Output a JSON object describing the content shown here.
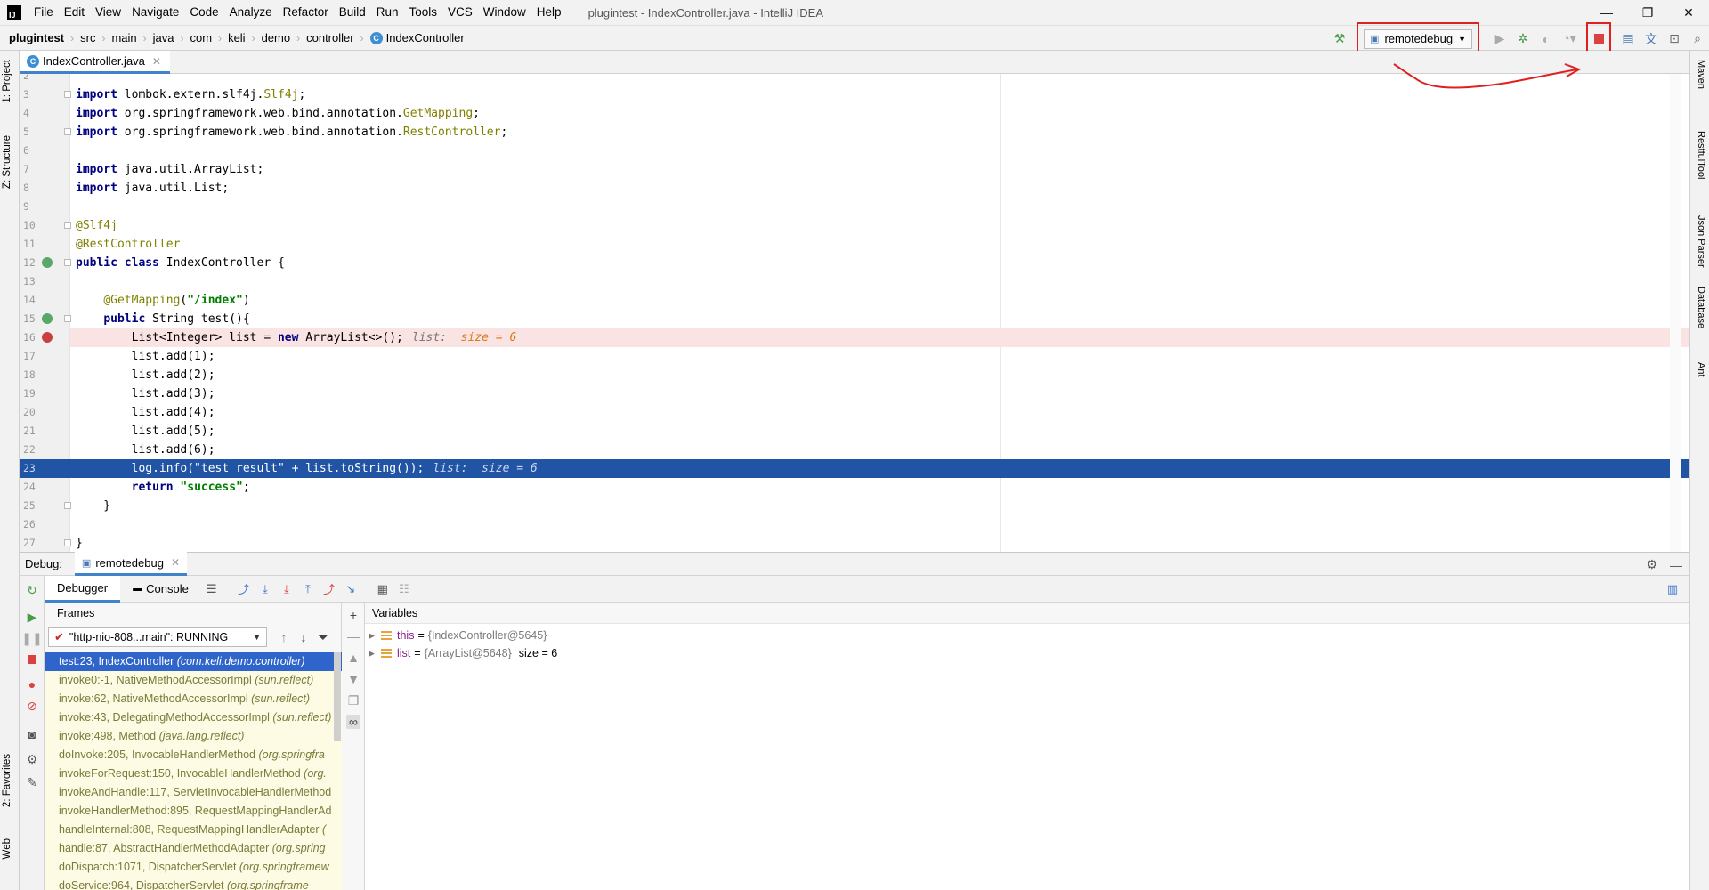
{
  "window": {
    "title": "plugintest - IndexController.java - IntelliJ IDEA",
    "menu": [
      "File",
      "Edit",
      "View",
      "Navigate",
      "Code",
      "Analyze",
      "Refactor",
      "Build",
      "Run",
      "Tools",
      "VCS",
      "Window",
      "Help"
    ],
    "controls": {
      "minimize": "—",
      "maximize": "❐",
      "close": "✕"
    }
  },
  "breadcrumb": {
    "project": "plugintest",
    "items": [
      "src",
      "main",
      "java",
      "com",
      "keli",
      "demo",
      "controller"
    ],
    "class_name": "IndexController"
  },
  "toolbar": {
    "run_config": "remotedebug",
    "accent_red": "#e02020"
  },
  "left_tool_tabs": {
    "project": "1: Project",
    "structure": "Z: Structure",
    "favorites": "2: Favorites",
    "web": "Web"
  },
  "right_tool_tabs": {
    "maven": "Maven",
    "restful": "RestfulTool",
    "json": "Json Parser",
    "database": "Database",
    "ant": "Ant"
  },
  "editor": {
    "tab": "IndexController.java",
    "lines": [
      {
        "n": "2",
        "html": ""
      },
      {
        "n": "3",
        "html": "<span class='kw'>import</span> lombok.extern.slf4j.<span class='ann'>Slf4j</span>;"
      },
      {
        "n": "4",
        "html": "<span class='kw'>import</span> org.springframework.web.bind.annotation.<span class='ann'>GetMapping</span>;"
      },
      {
        "n": "5",
        "html": "<span class='kw'>import</span> org.springframework.web.bind.annotation.<span class='ann'>RestController</span>;"
      },
      {
        "n": "6",
        "html": ""
      },
      {
        "n": "7",
        "html": "<span class='kw'>import</span> java.util.ArrayList;"
      },
      {
        "n": "8",
        "html": "<span class='kw'>import</span> java.util.List;"
      },
      {
        "n": "9",
        "html": ""
      },
      {
        "n": "10",
        "html": "<span class='ann'>@Slf4j</span>"
      },
      {
        "n": "11",
        "html": "<span class='ann'>@RestController</span>"
      },
      {
        "n": "12",
        "html": "<span class='kw'>public class</span> IndexController {"
      },
      {
        "n": "13",
        "html": ""
      },
      {
        "n": "14",
        "html": "    <span class='ann'>@GetMapping</span>(<span class='str'>\"/index\"</span>)"
      },
      {
        "n": "15",
        "html": "    <span class='kw'>public</span> String test(){"
      },
      {
        "n": "16",
        "html": "        List&lt;Integer&gt; list = <span class='kw'>new</span> ArrayList&lt;&gt;();<span class='inline-hint'>list:</span>  <span class='hint-val'>size = 6</span>"
      },
      {
        "n": "17",
        "html": "        list.add(1);"
      },
      {
        "n": "18",
        "html": "        list.add(2);"
      },
      {
        "n": "19",
        "html": "        list.add(3);"
      },
      {
        "n": "20",
        "html": "        list.add(4);"
      },
      {
        "n": "21",
        "html": "        list.add(5);"
      },
      {
        "n": "22",
        "html": "        list.add(6);"
      },
      {
        "n": "23",
        "html": "        log.info(\"test result\" + list.toString());<span class='inline-hint'>list:</span>  <span class='hint-val'>size = 6</span>"
      },
      {
        "n": "24",
        "html": "        <span class='kw'>return</span> <span class='str'>\"success\"</span>;"
      },
      {
        "n": "25",
        "html": "    }"
      },
      {
        "n": "26",
        "html": ""
      },
      {
        "n": "27",
        "html": "}"
      }
    ]
  },
  "debug": {
    "label": "Debug:",
    "session": "remotedebug",
    "tabs": {
      "debugger": "Debugger",
      "console": "Console"
    },
    "frames_title": "Frames",
    "thread": "\"http-nio-808...main\": RUNNING",
    "frames": [
      {
        "method": "test:23, IndexController",
        "pkg": "(com.keli.demo.controller)"
      },
      {
        "method": "invoke0:-1, NativeMethodAccessorImpl",
        "pkg": "(sun.reflect)"
      },
      {
        "method": "invoke:62, NativeMethodAccessorImpl",
        "pkg": "(sun.reflect)"
      },
      {
        "method": "invoke:43, DelegatingMethodAccessorImpl",
        "pkg": "(sun.reflect)"
      },
      {
        "method": "invoke:498, Method",
        "pkg": "(java.lang.reflect)"
      },
      {
        "method": "doInvoke:205, InvocableHandlerMethod",
        "pkg": "(org.springfra"
      },
      {
        "method": "invokeForRequest:150, InvocableHandlerMethod",
        "pkg": "(org."
      },
      {
        "method": "invokeAndHandle:117, ServletInvocableHandlerMethod",
        "pkg": ""
      },
      {
        "method": "invokeHandlerMethod:895, RequestMappingHandlerAd",
        "pkg": ""
      },
      {
        "method": "handleInternal:808, RequestMappingHandlerAdapter",
        "pkg": "("
      },
      {
        "method": "handle:87, AbstractHandlerMethodAdapter",
        "pkg": "(org.spring"
      },
      {
        "method": "doDispatch:1071, DispatcherServlet",
        "pkg": "(org.springframew"
      },
      {
        "method": "doService:964, DispatcherServlet",
        "pkg": "(org.springframe"
      }
    ],
    "variables_title": "Variables",
    "variables": [
      {
        "name": "this",
        "value": "{IndexController@5645}",
        "extra": ""
      },
      {
        "name": "list",
        "value": "{ArrayList@5648}",
        "extra": "size = 6"
      }
    ]
  }
}
